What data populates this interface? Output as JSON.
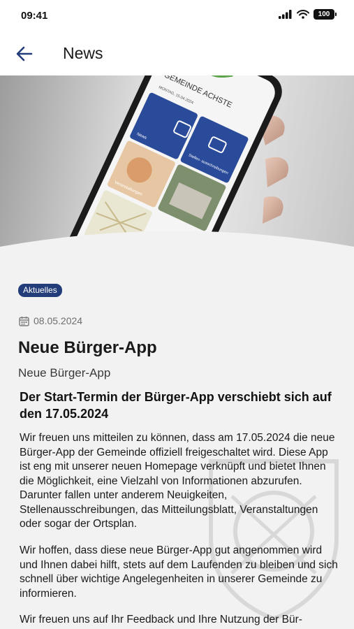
{
  "status_bar": {
    "time": "09:41",
    "battery": "100",
    "icons": [
      "signal-icon",
      "wifi-icon",
      "battery-icon"
    ]
  },
  "header": {
    "title": "News",
    "back_icon": "arrow-left-icon"
  },
  "hero": {
    "phone_screen": {
      "logo_text": "GEMEINDE ACHSTE",
      "date_text": "MONTAG, 15.04.2024",
      "tile_news": "News",
      "tile_jobs": "Stellen-\nausschreibungen",
      "tile_events": "Veranstaltungen"
    }
  },
  "article": {
    "category": "Aktuelles",
    "date": "08.05.2024",
    "title": "Neue Bürger-App",
    "subtitle": "Neue Bürger-App",
    "heading": "Der Start-Termin der Bürger-App verschiebt sich auf den 17.05.2024",
    "paragraphs": [
      "Wir freuen uns mitteilen zu können, dass am 17.05.2024 die neue Bürger-App der Gemeinde offiziell freigeschaltet wird. Diese App ist eng mit unserer neuen Homepage verknüpft und bietet Ihnen die Möglichkeit, eine Vielzahl von Informationen abzurufen. Darunter fallen unter anderem Neuigkeiten, Stellenausschreibungen, das Mitteilungsblatt, Veranstaltungen oder sogar der Ortsplan.",
      "Wir hoffen, dass diese neue Bürger-App gut angenommen wird und Ihnen dabei hilft, stets auf dem Laufenden zu bleiben und sich schnell über wichtige Angelegenheiten in unserer Gemeinde zu informieren.",
      "Wir freuen uns auf Ihr Feedback und Ihre Nutzung der Bür-"
    ]
  },
  "colors": {
    "accent": "#233c7a",
    "background": "#f2f2f2",
    "header_bg": "#ffffff"
  }
}
